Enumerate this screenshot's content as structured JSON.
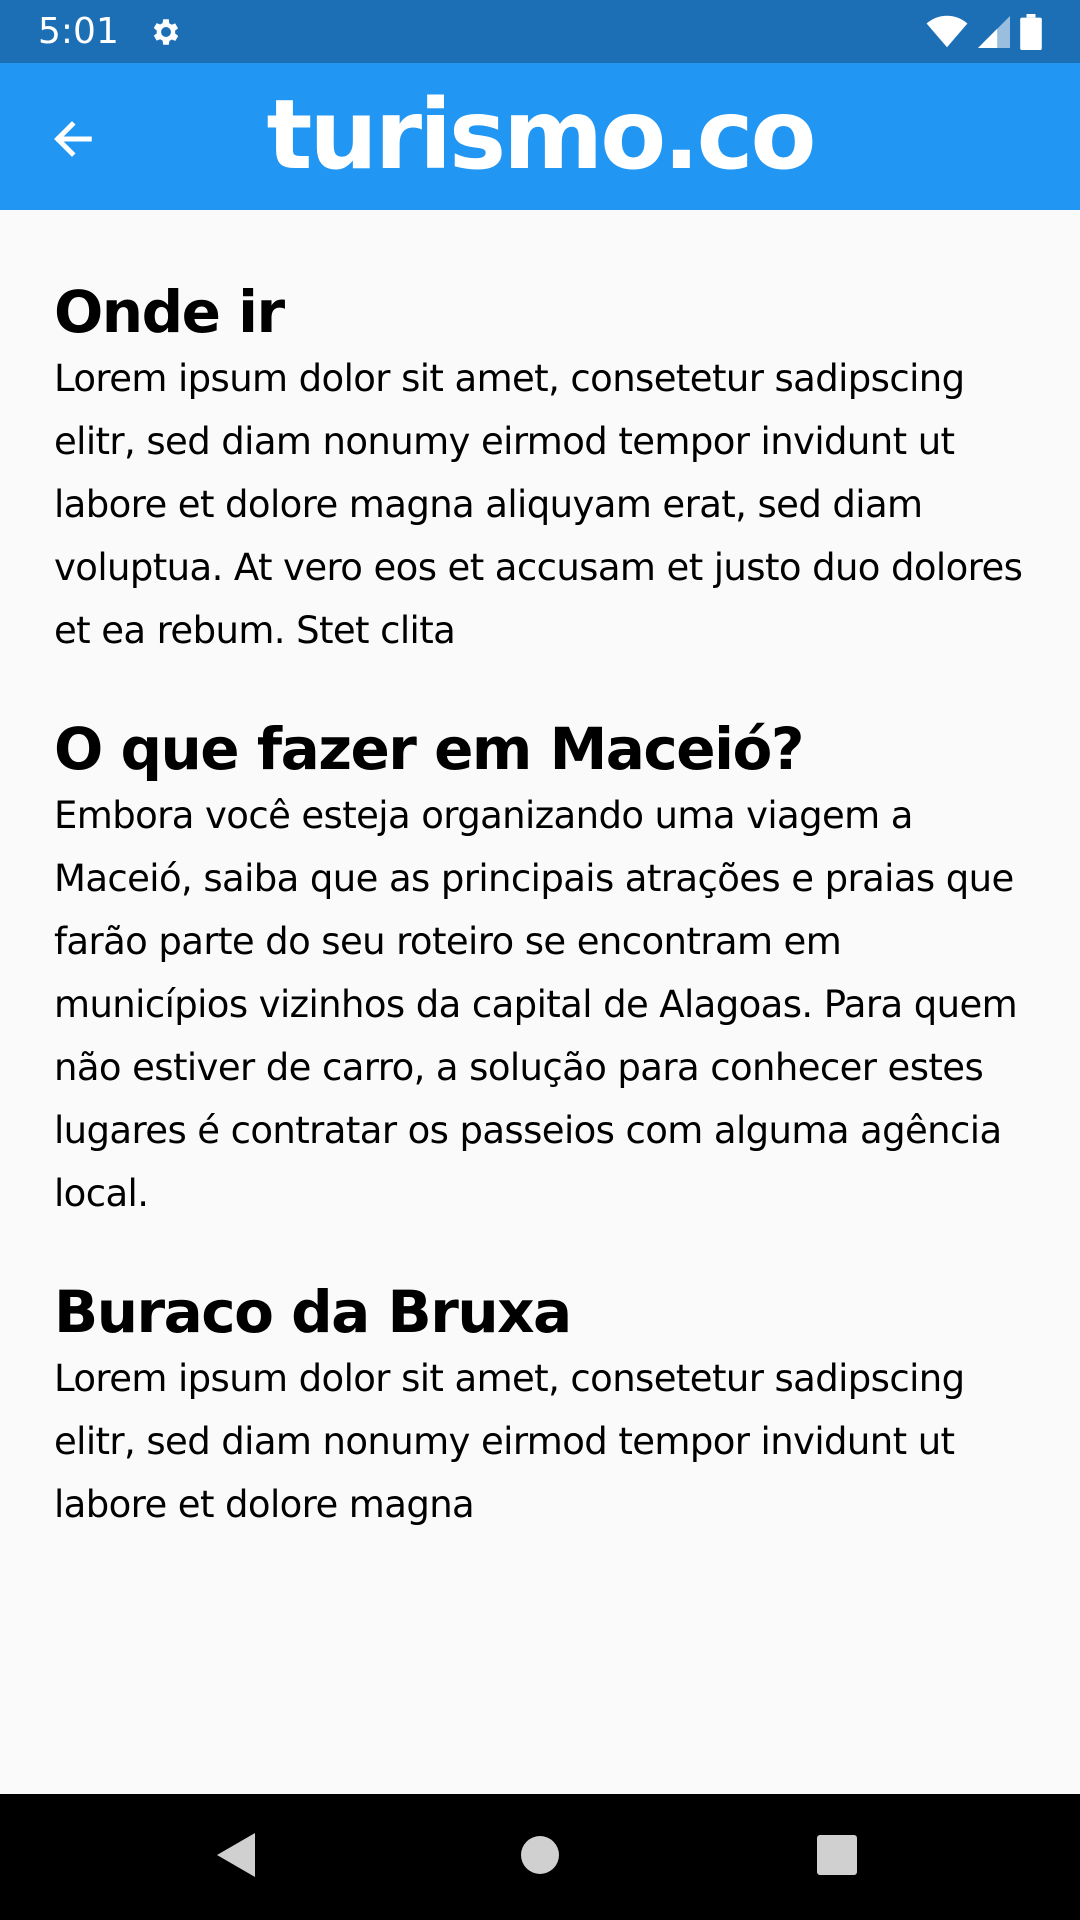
{
  "status_bar": {
    "time": "5:01",
    "icons": [
      "gear-icon",
      "wifi-icon",
      "signal-icon",
      "battery-icon"
    ],
    "color": "#1d6fb5"
  },
  "app_bar": {
    "title": "turismo.co",
    "back_icon": "arrow-back-icon",
    "color": "#2196f3"
  },
  "sections": [
    {
      "heading": "Onde ir",
      "body": "Lorem ipsum dolor sit amet, consetetur sadipscing elitr, sed diam nonumy eirmod tempor invidunt ut labore et dolore magna aliquyam erat, sed diam voluptua. At vero eos et accusam et justo duo dolores et ea rebum. Stet clita"
    },
    {
      "heading": "O que fazer em Maceió?",
      "body": "Embora você esteja organizando uma viagem a Maceió, saiba que as principais atrações e praias que farão parte do seu roteiro se encontram em municípios vizinhos da capital de Alagoas. Para quem não estiver de carro, a solução para conhecer estes lugares é contratar os passeios com alguma agência local."
    },
    {
      "heading": "Buraco da Bruxa",
      "body": "Lorem ipsum dolor sit amet, consetetur sadipscing elitr, sed diam nonumy eirmod tempor invidunt ut labore et dolore magna"
    }
  ],
  "nav_bar": {
    "icons": [
      "nav-back-icon",
      "nav-home-icon",
      "nav-recents-icon"
    ]
  }
}
